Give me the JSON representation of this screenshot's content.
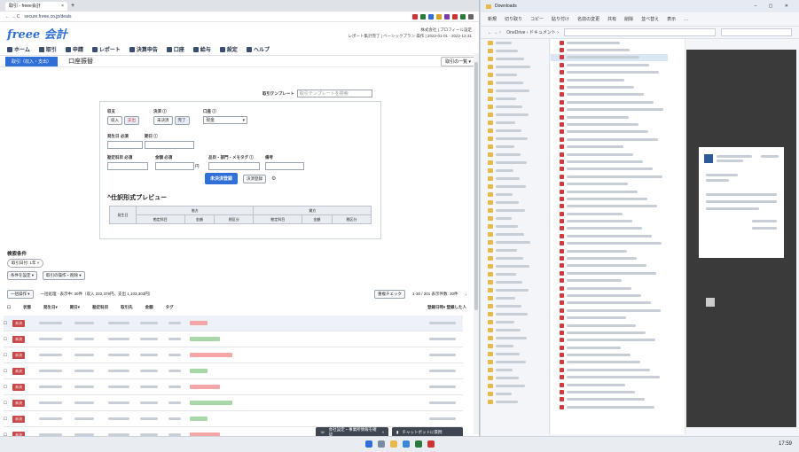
{
  "browser": {
    "tab_title": "取引 - freee会計",
    "tab_close": "×",
    "tab_new": "+",
    "nav_glyphs": "← → C",
    "url": "secure.freee.co.jp/deals",
    "header_info_line1": "株式会社 | プロフィール設定",
    "header_info_line2": "レポート集計完了 | ベーシックプラン 操作 | 2022-01-01 - 2022-12-31",
    "logo": "freee 会計",
    "nav": [
      {
        "label": "ホーム"
      },
      {
        "label": "取引"
      },
      {
        "label": "申請"
      },
      {
        "label": "レポート"
      },
      {
        "label": "決算申告"
      },
      {
        "label": "口座"
      },
      {
        "label": "給与"
      },
      {
        "label": "設定"
      },
      {
        "label": "ヘルプ"
      }
    ],
    "subtabs": {
      "active": "取引（収入・支出）",
      "second": "口座振替",
      "right_select": "取引の一覧 ▾"
    },
    "template": {
      "label": "取引テンプレート",
      "placeholder": "取引テンプレートを検索"
    },
    "form": {
      "label_type": "収支",
      "btn_income": "収入",
      "btn_expense": "支出",
      "label_status": "決済 ⓘ",
      "btn_unsettled": "未決済",
      "btn_settled": "完了",
      "label_account": "口座 ⓘ",
      "account_value": "現金",
      "label_date": "発生日 必須",
      "label_due": "期日 ⓘ",
      "label_partner": "勘定科目 必須",
      "label_amount": "金額 必須",
      "amount_unit": "円",
      "label_item": "品目・部門・メモタグ ⓘ",
      "label_remark": "備考",
      "btn_register": "未決済登録",
      "btn_settle_register": "決済登録",
      "preview_title": "仕訳形式プレビュー",
      "preview": {
        "col1": "発生日",
        "debit": "借方",
        "credit": "貸方",
        "sub": [
          "勘定科目",
          "金額",
          "税区分",
          "勘定科目",
          "金額",
          "税区分"
        ]
      }
    },
    "list": {
      "title": "検索条件",
      "chip": "取引日付: 1年 ×",
      "filter1": "条件を設定 ▾",
      "filter2": "取引の操作・削除 ▾",
      "bulk": "一括操作 ▾",
      "summary": "一括処理 · 表示中: 30件（収入 222,379円、支出 1,103,303円）",
      "check_btn": "重複チェック",
      "paging": "1-30 / 201 表示件数: 30件",
      "col_headers": [
        "状態",
        "発生日▾",
        "期日▾",
        "勘定科目",
        "取引先",
        "金額",
        "タグ",
        "登録日時▾ 登録した人"
      ],
      "status_label": "未決"
    },
    "toast1": "会社設定・事業所情報を確認",
    "toast1_chevron": "^",
    "toast2": "チャットボットに質問"
  },
  "explorer": {
    "title": "Downloads",
    "toolbar": [
      "新規",
      "切り取り",
      "コピー",
      "貼り付け",
      "名前の変更",
      "共有",
      "削除",
      "並べ替え",
      "表示",
      "…"
    ],
    "address": "OneDrive › ドキュメント ›"
  },
  "taskbar": {
    "time": "17:59"
  },
  "colors": {
    "accent": "#2f6fd6",
    "status_red": "#c94a4a",
    "green": "#5cb85c"
  }
}
